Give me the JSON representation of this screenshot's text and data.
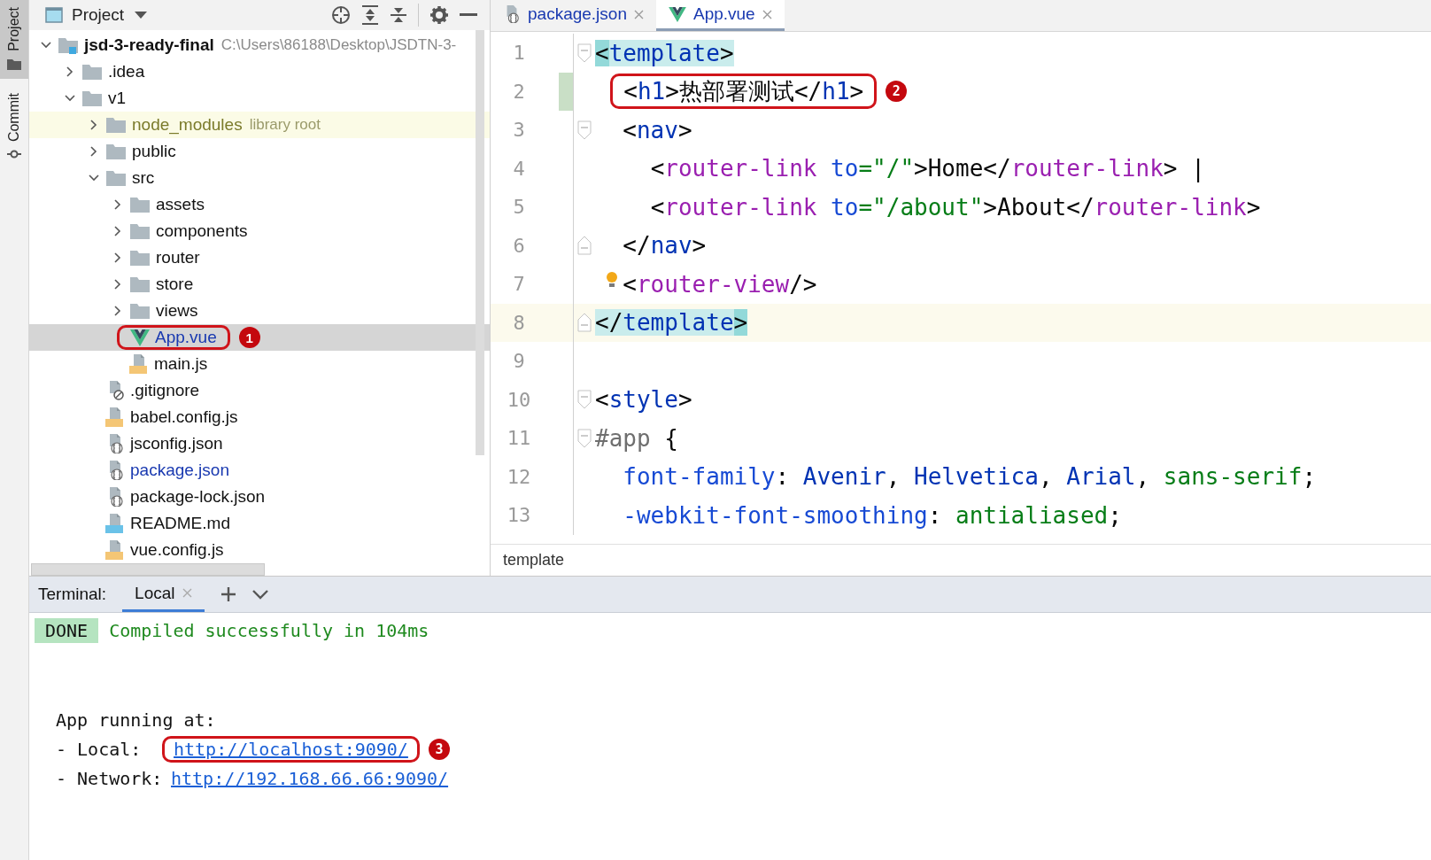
{
  "tool_strip": [
    {
      "label": "Project",
      "kind": "folder",
      "selected": true
    },
    {
      "label": "Commit",
      "kind": "commit",
      "selected": false
    }
  ],
  "project_panel": {
    "title": "Project",
    "tree": [
      {
        "name": "jsd-3-ready-final",
        "hint": "C:\\Users\\86188\\Desktop\\JSDTN-3-",
        "kind": "module",
        "expanded": true,
        "children": [
          {
            "name": ".idea",
            "kind": "folder",
            "expanded": false
          },
          {
            "name": "v1",
            "kind": "folder",
            "expanded": true,
            "children": [
              {
                "name": "node_modules",
                "hint": "library root",
                "kind": "folder",
                "library": true,
                "expanded": false
              },
              {
                "name": "public",
                "kind": "folder",
                "expanded": false
              },
              {
                "name": "src",
                "kind": "folder",
                "expanded": true,
                "children": [
                  {
                    "name": "assets",
                    "kind": "folder",
                    "expanded": false
                  },
                  {
                    "name": "components",
                    "kind": "folder",
                    "expanded": false
                  },
                  {
                    "name": "router",
                    "kind": "folder",
                    "expanded": false
                  },
                  {
                    "name": "store",
                    "kind": "folder",
                    "expanded": false
                  },
                  {
                    "name": "views",
                    "kind": "folder",
                    "expanded": false
                  },
                  {
                    "name": "App.vue",
                    "kind": "vue",
                    "modified": true,
                    "selected": true,
                    "callout": "1"
                  },
                  {
                    "name": "main.js",
                    "kind": "js",
                    "modified": false,
                    "selected": false
                  }
                ]
              },
              {
                "name": ".gitignore",
                "kind": "git",
                "modified": false,
                "selected": false
              },
              {
                "name": "babel.config.js",
                "kind": "js",
                "modified": false,
                "selected": false
              },
              {
                "name": "jsconfig.json",
                "kind": "json",
                "modified": false,
                "selected": false
              },
              {
                "name": "package.json",
                "kind": "json",
                "modified": true,
                "selected": false
              },
              {
                "name": "package-lock.json",
                "kind": "json",
                "modified": false,
                "selected": false
              },
              {
                "name": "README.md",
                "kind": "md",
                "modified": false,
                "selected": false
              },
              {
                "name": "vue.config.js",
                "kind": "js",
                "modified": false,
                "selected": false
              }
            ]
          }
        ]
      }
    ]
  },
  "editor": {
    "tabs": [
      {
        "label": "package.json",
        "kind": "json",
        "selected": false,
        "modified": true
      },
      {
        "label": "App.vue",
        "kind": "vue",
        "selected": true,
        "modified": true
      }
    ],
    "lines": [
      {
        "number": "1",
        "kind": "fold-start",
        "tokens": [
          {
            "text": "<",
            "kind": "brace-match"
          },
          {
            "text": "template",
            "kind": "tag",
            "matched": true
          },
          {
            "text": ">",
            "kind": "punct",
            "matched": true
          }
        ]
      },
      {
        "number": "2",
        "kind": "plain",
        "changed": true,
        "callout": "2",
        "tokens": [
          {
            "text": "  <",
            "kind": "punct"
          },
          {
            "text": "h1",
            "kind": "tag"
          },
          {
            "text": ">热部署测试</",
            "kind": "punct"
          },
          {
            "text": "h1",
            "kind": "tag"
          },
          {
            "text": ">",
            "kind": "punct"
          }
        ]
      },
      {
        "number": "3",
        "kind": "fold-start",
        "tokens": [
          {
            "text": "  <",
            "kind": "punct"
          },
          {
            "text": "nav",
            "kind": "tag"
          },
          {
            "text": ">",
            "kind": "punct"
          }
        ]
      },
      {
        "number": "4",
        "kind": "plain",
        "tokens": [
          {
            "text": "    <",
            "kind": "punct"
          },
          {
            "text": "router-link",
            "kind": "comp"
          },
          {
            "text": " to",
            "kind": "attr"
          },
          {
            "text": "=\"/\"",
            "kind": "string"
          },
          {
            "text": ">Home</",
            "kind": "punct"
          },
          {
            "text": "router-link",
            "kind": "comp"
          },
          {
            "text": "> |",
            "kind": "punct"
          }
        ]
      },
      {
        "number": "5",
        "kind": "plain",
        "tokens": [
          {
            "text": "    <",
            "kind": "punct"
          },
          {
            "text": "router-link",
            "kind": "comp"
          },
          {
            "text": " to",
            "kind": "attr"
          },
          {
            "text": "=\"/about\"",
            "kind": "string"
          },
          {
            "text": ">About</",
            "kind": "punct"
          },
          {
            "text": "router-link",
            "kind": "comp"
          },
          {
            "text": ">",
            "kind": "punct"
          }
        ]
      },
      {
        "number": "6",
        "kind": "fold-end",
        "tokens": [
          {
            "text": "  </",
            "kind": "punct"
          },
          {
            "text": "nav",
            "kind": "tag"
          },
          {
            "text": ">",
            "kind": "punct"
          }
        ]
      },
      {
        "number": "7",
        "kind": "plain",
        "bulb": true,
        "tokens": [
          {
            "text": "  <",
            "kind": "punct"
          },
          {
            "text": "router-view",
            "kind": "comp"
          },
          {
            "text": "/>",
            "kind": "punct"
          }
        ]
      },
      {
        "number": "8",
        "kind": "fold-end",
        "current": true,
        "tokens": [
          {
            "text": "</",
            "kind": "punct",
            "matched": true
          },
          {
            "text": "template",
            "kind": "tag",
            "matched": true
          },
          {
            "text": ">",
            "kind": "brace-match"
          }
        ]
      },
      {
        "number": "9",
        "kind": "plain"
      },
      {
        "number": "10",
        "kind": "fold-start",
        "tokens": [
          {
            "text": "<",
            "kind": "punct"
          },
          {
            "text": "style",
            "kind": "tag"
          },
          {
            "text": ">",
            "kind": "punct"
          }
        ]
      },
      {
        "number": "11",
        "kind": "fold-start",
        "tokens": [
          {
            "text": "#app",
            "kind": "selector"
          },
          {
            "text": " {",
            "kind": "punct"
          }
        ]
      },
      {
        "number": "12",
        "kind": "plain",
        "tokens": [
          {
            "text": "  font-family",
            "kind": "prop"
          },
          {
            "text": ": ",
            "kind": "punct"
          },
          {
            "text": "Avenir",
            "kind": "value"
          },
          {
            "text": ", ",
            "kind": "punct"
          },
          {
            "text": "Helvetica",
            "kind": "value"
          },
          {
            "text": ", ",
            "kind": "punct"
          },
          {
            "text": "Arial",
            "kind": "value"
          },
          {
            "text": ", ",
            "kind": "punct"
          },
          {
            "text": "sans-serif",
            "kind": "keyword"
          },
          {
            "text": ";",
            "kind": "punct"
          }
        ]
      },
      {
        "number": "13",
        "kind": "plain",
        "tokens": [
          {
            "text": "  -webkit-font-smoothing",
            "kind": "prop"
          },
          {
            "text": ": ",
            "kind": "punct"
          },
          {
            "text": "antialiased",
            "kind": "keyword"
          },
          {
            "text": ";",
            "kind": "punct"
          }
        ]
      }
    ],
    "breadcrumb": "template"
  },
  "terminal": {
    "label": "Terminal:",
    "tabs": [
      {
        "label": "Local",
        "selected": true
      }
    ],
    "status": {
      "badge": "DONE",
      "text": "Compiled successfully in 104ms"
    },
    "title": "App running at:",
    "entries": [
      {
        "label": "- Local:",
        "url": "http://localhost:9090/",
        "callout": "3"
      },
      {
        "label": "- Network:",
        "url": "http://192.168.66.66:9090/"
      }
    ]
  }
}
